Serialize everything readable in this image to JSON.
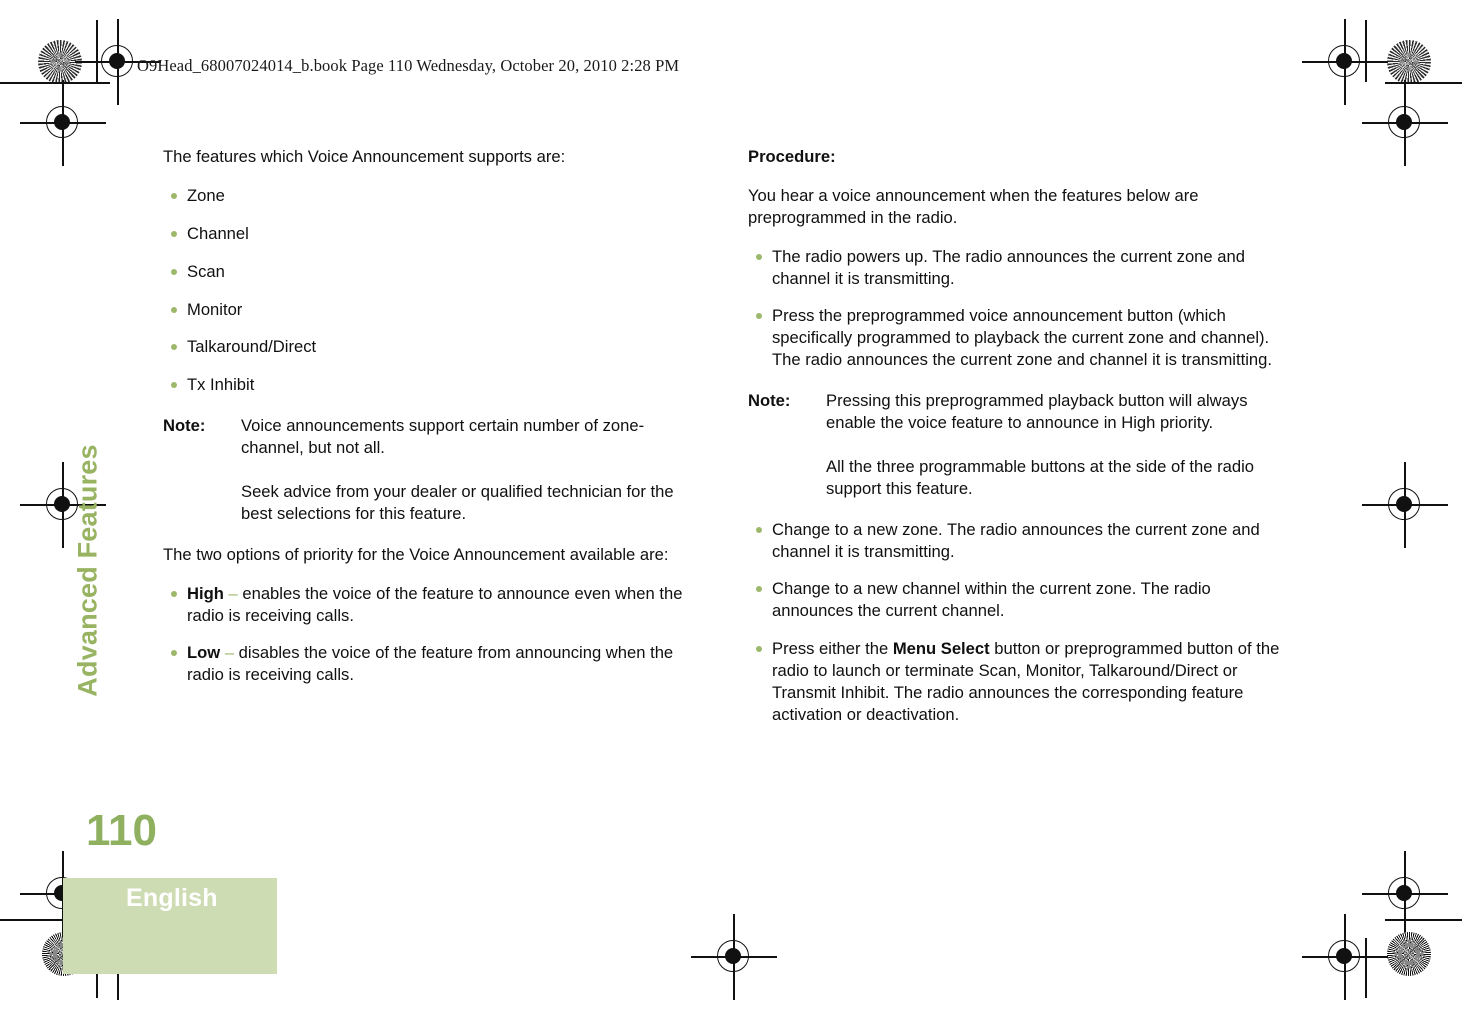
{
  "header": {
    "file_info": "O9Head_68007024014_b.book  Page 110  Wednesday, October 20, 2010  2:28 PM"
  },
  "sidebar": {
    "chapter_tab": "Advanced Features",
    "page_number": "110",
    "language": "English"
  },
  "colors": {
    "accent_green": "#8fb05f",
    "bullet_green": "#9cb86b",
    "tab_green": "#98b463",
    "language_block": "#cedcb4",
    "text": "#101010"
  },
  "left_column": {
    "intro": "The features which Voice Announcement supports are:",
    "feature_bullets": [
      "Zone",
      "Channel",
      "Scan",
      "Monitor",
      "Talkaround/Direct",
      "Tx Inhibit"
    ],
    "note": {
      "label": "Note:",
      "paragraphs": [
        "Voice announcements support certain number of zone-channel, but not all.",
        "Seek advice from your dealer or qualified technician for the best selections for this feature."
      ]
    },
    "priority_intro": "The two options of priority for the Voice Announcement available are:",
    "priority_options": [
      {
        "term": "High",
        "dash": "–",
        "description": "enables the voice of the feature to announce even when the radio is receiving calls."
      },
      {
        "term": "Low",
        "dash": "–",
        "description": "disables the voice of the feature from announcing when the radio is receiving calls."
      }
    ]
  },
  "right_column": {
    "procedure_heading": "Procedure:",
    "procedure_intro": "You hear a voice announcement when the features below are preprogrammed in the radio.",
    "bullets_before_note": [
      "The radio powers up. The radio announces the current zone and channel it is transmitting.",
      "Press the preprogrammed voice announcement button (which specifically programmed to playback the current zone and channel). The radio announces the current zone and channel it is transmitting."
    ],
    "note": {
      "label": "Note:",
      "paragraphs": [
        "Pressing this preprogrammed playback button will always enable the voice feature to announce in High priority.",
        "All the three programmable buttons at the side of the radio support this feature."
      ]
    },
    "bullets_after_note": [
      "Change to a new zone. The radio announces the current zone and channel it is transmitting.",
      "Change to a new channel within the current zone. The radio announces the current channel."
    ],
    "menu_select_bullet": {
      "before": "Press either the ",
      "bold": "Menu Select",
      "after": " button or preprogrammed button of the radio to launch or terminate Scan, Monitor, Talkaround/Direct or Transmit Inhibit. The radio announces the corresponding feature activation or deactivation."
    }
  }
}
